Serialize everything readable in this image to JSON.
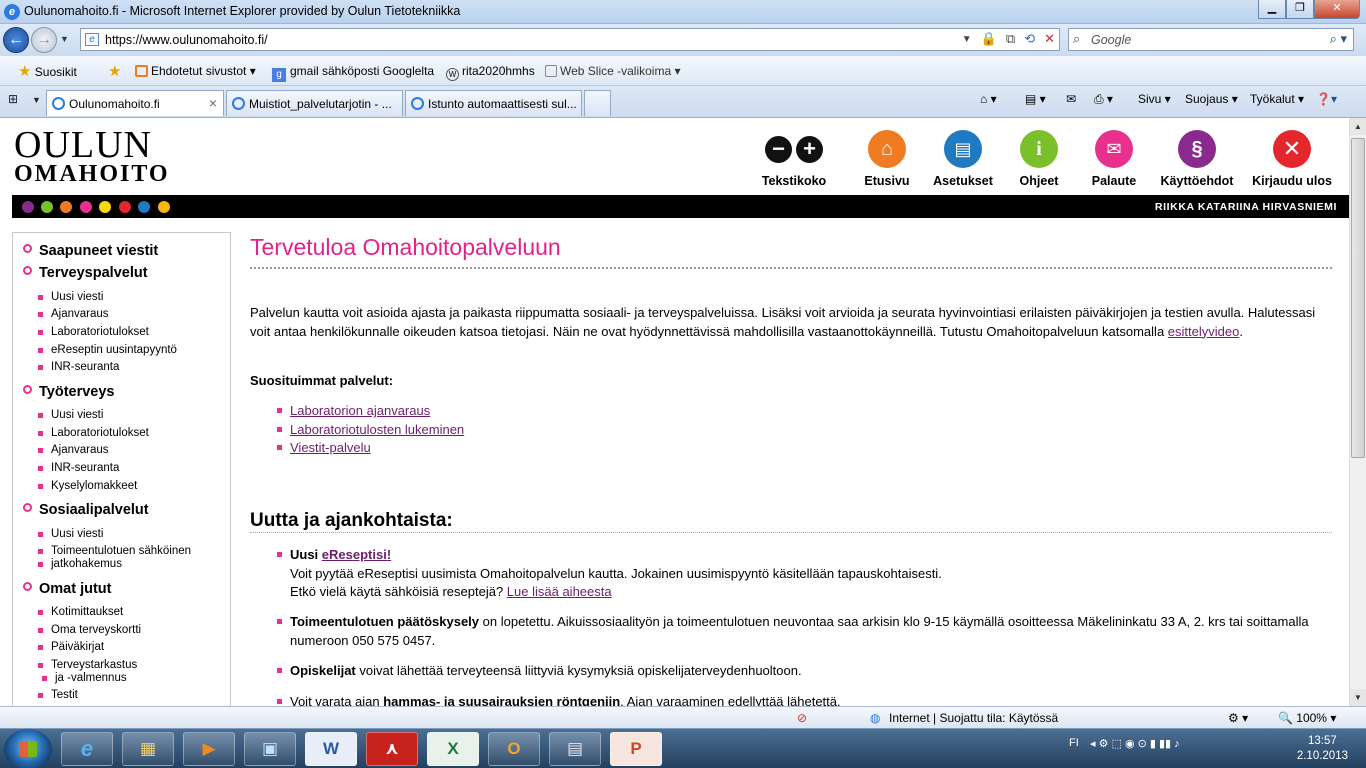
{
  "window": {
    "title": "Oulunomahoito.fi - Microsoft Internet Explorer provided by Oulun Tietotekniikka"
  },
  "address_bar": {
    "url": "https://www.oulunomahoito.fi/",
    "search_placeholder": "Google"
  },
  "favorites_bar": {
    "favorites_label": "Suosikit",
    "items": [
      "Ehdotetut sivustot ▾",
      "gmail sähköposti Googlelta",
      "rita2020hmhs",
      "Web Slice -valikoima ▾"
    ]
  },
  "tabs": [
    {
      "label": "Oulunomahoito.fi",
      "active": true
    },
    {
      "label": "Muistiot_palvelutarjotin - ...",
      "active": false
    },
    {
      "label": "Istunto automaattisesti sul...",
      "active": false
    }
  ],
  "command_bar": {
    "items": [
      "Sivu ▾",
      "Suojaus ▾",
      "Työkalut ▾"
    ]
  },
  "site": {
    "logo_line1": "OULUN",
    "logo_line2": "OMAHOITO",
    "nav": [
      {
        "label": "Tekstikoko"
      },
      {
        "label": "Etusivu",
        "color": "#f07b22"
      },
      {
        "label": "Asetukset",
        "color": "#1f7ac2"
      },
      {
        "label": "Ohjeet",
        "color": "#7bbf2a"
      },
      {
        "label": "Palaute",
        "color": "#e8318c"
      },
      {
        "label": "Käyttöehdot",
        "color": "#8b2a8e"
      },
      {
        "label": "Kirjaudu ulos",
        "color": "#e4262d"
      }
    ],
    "brand_dots": [
      "#8b2a8e",
      "#7bbf2a",
      "#f07b22",
      "#e8318c",
      "#f5d90a",
      "#e4262d",
      "#1f7ac2",
      "#f5b50a"
    ],
    "user_name": "RIIKKA KATARIINA HIRVASNIEMI"
  },
  "left_menu": {
    "sections": [
      {
        "title": "Saapuneet viestit",
        "items": []
      },
      {
        "title": "Terveyspalvelut",
        "items": [
          "Uusi viesti",
          "Ajanvaraus",
          "Laboratoriotulokset",
          "eReseptin uusintapyyntö",
          "INR-seuranta"
        ]
      },
      {
        "title": "Työterveys",
        "items": [
          "Uusi viesti",
          "Laboratoriotulokset",
          "Ajanvaraus",
          "INR-seuranta",
          "Kyselylomakkeet"
        ]
      },
      {
        "title": "Sosiaalipalvelut",
        "items": [
          "Uusi viesti",
          "Toimeentulotuen sähköinen",
          "jatkohakemus"
        ]
      },
      {
        "title": "Omat jutut",
        "items": [
          "Kotimittaukset",
          "Oma terveyskortti",
          "Päiväkirjat",
          "Terveystarkastus",
          "ja -valmennus",
          "Testit"
        ]
      }
    ]
  },
  "content": {
    "heading": "Tervetuloa Omahoitopalveluun",
    "intro": "Palvelun kautta voit asioida ajasta ja paikasta riippumatta sosiaali- ja terveyspalveluissa. Lisäksi voit arvioida ja seurata hyvinvointiasi erilaisten päiväkirjojen ja testien avulla. Halutessasi voit antaa henkilökunnalle oikeuden katsoa tietojasi. Näin ne ovat hyödynnettävissä mahdollisilla vastaanottokäynneillä. Tutustu Omahoitopalveluun katsomalla ",
    "intro_link": "esittelyvideo",
    "intro_end": ".",
    "popular_title": "Suosituimmat palvelut:",
    "popular_links": [
      "Laboratorion ajanvaraus",
      "Laboratoriotulosten lukeminen",
      "Viestit-palvelu"
    ],
    "news_title": "Uutta ja ajankohtaista:",
    "news": [
      {
        "bold": "Uusi ",
        "link": "eReseptisi!",
        "line2": "Voit pyytää eReseptisi uusimista Omahoitopalvelun kautta. Jokainen uusimispyyntö käsitellään tapauskohtaisesti.",
        "line3": "Etkö vielä käytä sähköisiä reseptejä? ",
        "link2": "Lue lisää aiheesta"
      },
      {
        "bold": "Toimeentulotuen päätöskysely",
        "text": " on lopetettu. Aikuissosiaalityön ja toimeentulotuen neuvontaa saa arkisin klo 9-15 käymällä osoitteessa Mäkelininkatu 33 A, 2. krs tai soittamalla numeroon 050 575 0457."
      },
      {
        "bold": "Opiskelijat",
        "text": " voivat lähettää terveyteensä liittyviä kysymyksiä opiskelijaterveydenhuoltoon."
      },
      {
        "pre": "Voit varata ajan ",
        "bold": "hammas- ja suusairauksien röntgeniin",
        "text": ". Ajan varaaminen edellyttää lähetettä."
      }
    ]
  },
  "status_bar": {
    "zone": "Internet | Suojattu tila: Käytössä",
    "zoom": "100%"
  },
  "taskbar": {
    "lang": "FI",
    "time": "13:57",
    "date": "2.10.2013"
  }
}
